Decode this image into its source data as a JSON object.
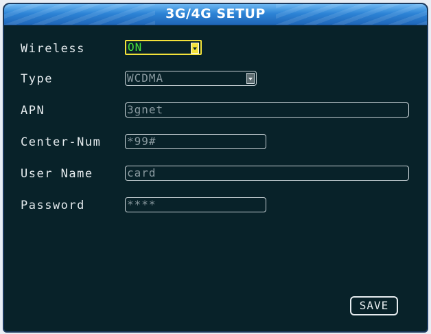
{
  "window": {
    "title": "3G/4G SETUP"
  },
  "fields": {
    "wireless": {
      "label": "Wireless",
      "value": "ON"
    },
    "type": {
      "label": "Type",
      "value": "WCDMA"
    },
    "apn": {
      "label": "APN",
      "value": "3gnet"
    },
    "center_num": {
      "label": "Center-Num",
      "value": "*99#"
    },
    "user_name": {
      "label": "User Name",
      "value": "card"
    },
    "password": {
      "label": "Password",
      "value": "****"
    }
  },
  "buttons": {
    "save": "SAVE"
  },
  "icons": {
    "dropdown": "chevron-down-icon"
  },
  "colors": {
    "background": "#082229",
    "title_bar": "#2d84d6",
    "focus_border": "#f3e23a",
    "active_value": "#48e33a",
    "label_text": "#e6ecef",
    "inactive_value": "#8a9aa0"
  }
}
